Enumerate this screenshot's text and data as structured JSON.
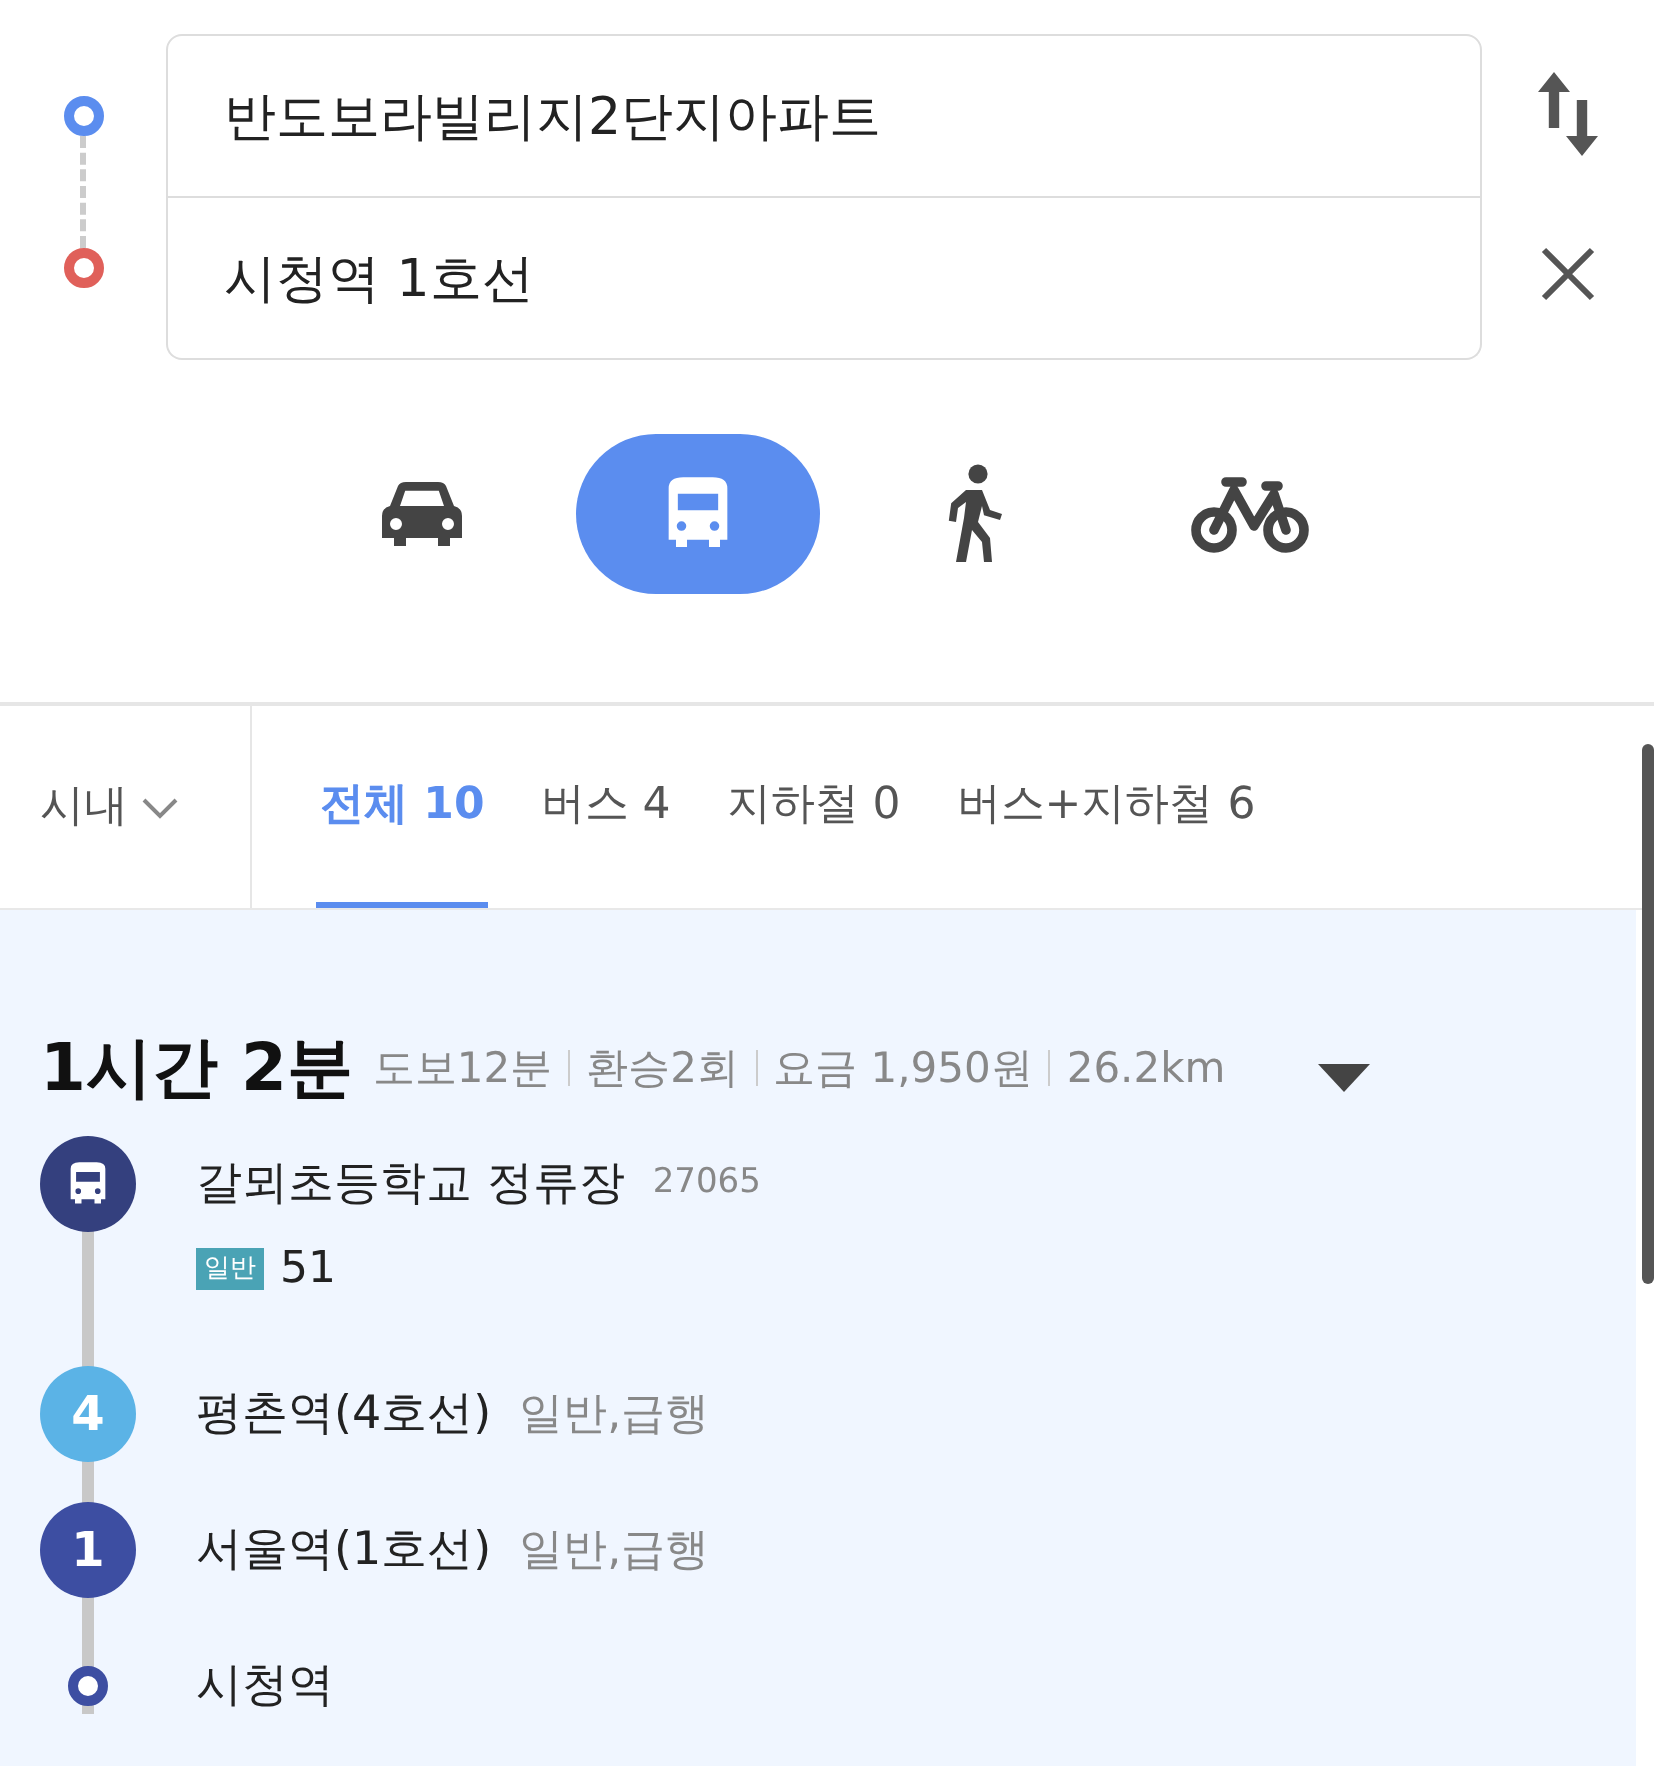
{
  "origin": {
    "value": "반도보라빌리지2단지아파트"
  },
  "destination": {
    "value": "시청역 1호선"
  },
  "modes": [
    {
      "kind": "car",
      "selected": false
    },
    {
      "kind": "bus",
      "selected": true
    },
    {
      "kind": "walk",
      "selected": false
    },
    {
      "kind": "bike",
      "selected": false
    }
  ],
  "region": {
    "label": "시내"
  },
  "tabs": [
    {
      "label": "전체 10",
      "selected": true
    },
    {
      "label": "버스 4",
      "selected": false
    },
    {
      "label": "지하철 0",
      "selected": false
    },
    {
      "label": "버스+지하철 6",
      "selected": false
    }
  ],
  "route": {
    "duration": "1시간 2분",
    "details": [
      "도보12분",
      "환승2회",
      "요금 1,950원",
      "26.2km"
    ],
    "steps": [
      {
        "kind": "bus",
        "color": "#34407e",
        "name": "갈뫼초등학교 정류장",
        "code": "27065",
        "bus_type": "일반",
        "bus_number": "51"
      },
      {
        "kind": "subway",
        "line": "4",
        "color": "#5bb3e6",
        "name": "평촌역(4호선)",
        "note": "일반,급행"
      },
      {
        "kind": "subway",
        "line": "1",
        "color": "#3d4ea2",
        "name": "서울역(1호선)",
        "note": "일반,급행"
      },
      {
        "kind": "end",
        "color": "#3d4ea2",
        "name": "시청역"
      }
    ]
  }
}
